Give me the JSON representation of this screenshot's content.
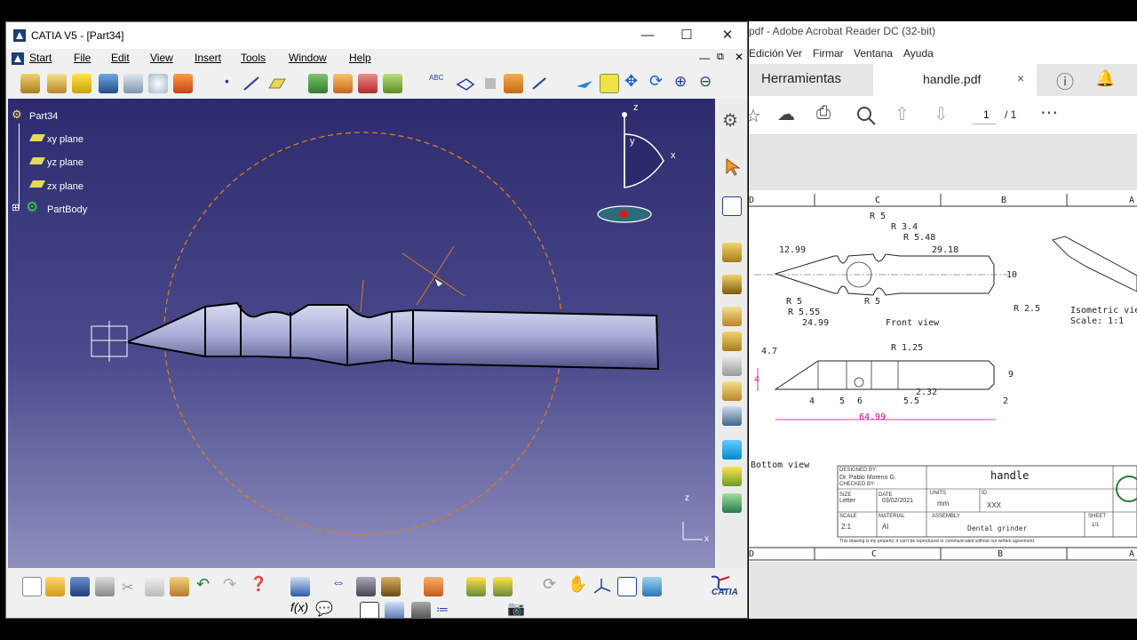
{
  "catia": {
    "title": "CATIA V5 - [Part34]",
    "menu": [
      "Start",
      "File",
      "Edit",
      "View",
      "Insert",
      "Tools",
      "Window",
      "Help"
    ],
    "tree": {
      "root": "Part34",
      "items": [
        "xy plane",
        "yz plane",
        "zx plane",
        "PartBody"
      ]
    },
    "compass": {
      "x": "x",
      "y": "y",
      "z": "z"
    },
    "axis_corner": {
      "x": "x",
      "z": "z"
    },
    "brand": "CATIA",
    "colors": {
      "viewport_top": "#2d2b6e",
      "viewport_bottom": "#8f8fbf",
      "sketch_circle": "#e07b1e",
      "tree_highlight": "#ffe066"
    }
  },
  "acrobat": {
    "title": "pdf - Adobe Acrobat Reader DC (32-bit)",
    "menu": [
      "Edición",
      "Ver",
      "Firmar",
      "Ventana",
      "Ayuda"
    ],
    "tabs": {
      "tools": "Herramientas",
      "doc": "handle.pdf",
      "close": "×"
    },
    "page": {
      "current": "1",
      "total": "/ 1"
    },
    "drawing": {
      "columns_top": [
        "D",
        "C",
        "B",
        "A"
      ],
      "columns_bottom": [
        "D",
        "C",
        "B",
        "A"
      ],
      "front_dims": {
        "r5_top": "R 5",
        "r34": "R 3.4",
        "r548": "R 5.48",
        "d1299": "12.99",
        "d2918": "29.18",
        "d10": "10",
        "r5_left": "R 5",
        "r5_mid": "R 5",
        "r555": "R 5.55",
        "d2499": "24.99",
        "r25": "R 2.5"
      },
      "front_label": "Front view",
      "iso_label": "Isometric view",
      "iso_scale": "Scale:  1:1",
      "bottom_dims": {
        "d47": "4.7",
        "r125": "R 1.25",
        "d4_left": "4",
        "d9": "9",
        "d4": "4",
        "d5": "5",
        "d6": "6",
        "d232": "2.32",
        "d55": "5.5",
        "d2": "2",
        "d6499": "64.99"
      },
      "bottom_label": "Bottom view",
      "title_block": {
        "designed_by_label": "DESIGNED BY:",
        "designed_by": "Dr. Pablo Moreno G.",
        "checked_by_label": "CHECKED BY:",
        "title": "handle",
        "units_label": "UNITS",
        "units": "mm",
        "id_label": "ID",
        "id": "XXX",
        "size_label": "SIZE",
        "size": "Letter",
        "date_label": "DATE",
        "date": "03/02/2021",
        "scale_label": "SCALE",
        "scale": "2:1",
        "material_label": "MATERIAL",
        "material": "Al",
        "assembly_label": "ASSEMBLY",
        "assembly": "Dental grinder",
        "sheet_label": "SHEET",
        "sheet": "1/1",
        "disclaimer": "This drawing is my property; it can't be reproduced or communicated without our written agreement."
      }
    },
    "colors": {
      "dim_magenta": "#d000a0",
      "tab_bg": "#e6e6e6"
    }
  }
}
